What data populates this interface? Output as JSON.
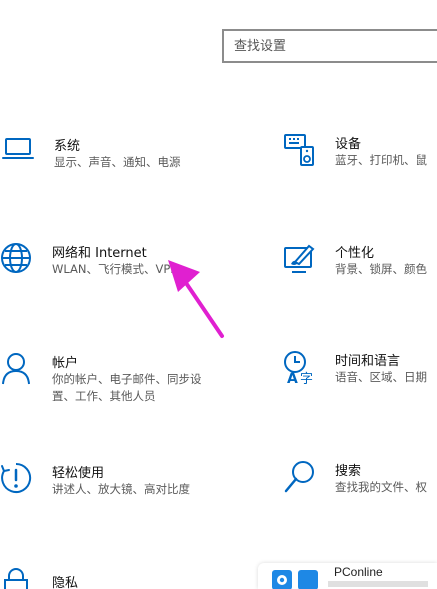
{
  "search": {
    "placeholder": "查找设置"
  },
  "tiles": [
    {
      "title": "系统",
      "desc": [
        "显示、声音、通知、电源"
      ],
      "icon": "laptop-icon"
    },
    {
      "title": "设备",
      "desc": [
        "蓝牙、打印机、鼠"
      ],
      "icon": "keyboard-speaker-icon"
    },
    {
      "title": "网络和 Internet",
      "desc": [
        "WLAN、飞行模式、VPN"
      ],
      "icon": "globe-icon"
    },
    {
      "title": "个性化",
      "desc": [
        "背景、锁屏、颜色"
      ],
      "icon": "paint-brush-monitor-icon"
    },
    {
      "title": "帐户",
      "desc": [
        "你的帐户、电子邮件、同步设",
        "置、工作、其他人员"
      ],
      "icon": "person-icon"
    },
    {
      "title": "时间和语言",
      "desc": [
        "语音、区域、日期"
      ],
      "icon": "clock-language-icon"
    },
    {
      "title": "轻松使用",
      "desc": [
        "讲述人、放大镜、高对比度"
      ],
      "icon": "ease-of-access-icon"
    },
    {
      "title": "搜索",
      "desc": [
        "查找我的文件、权"
      ],
      "icon": "search-icon"
    },
    {
      "title": "隐私",
      "desc": [],
      "icon": "lock-icon"
    }
  ],
  "watermark": {
    "text": "PConline"
  },
  "colors": {
    "accent": "#0067c0",
    "arrow": "#e020d0",
    "watermark_logo": "#1e88e5"
  }
}
